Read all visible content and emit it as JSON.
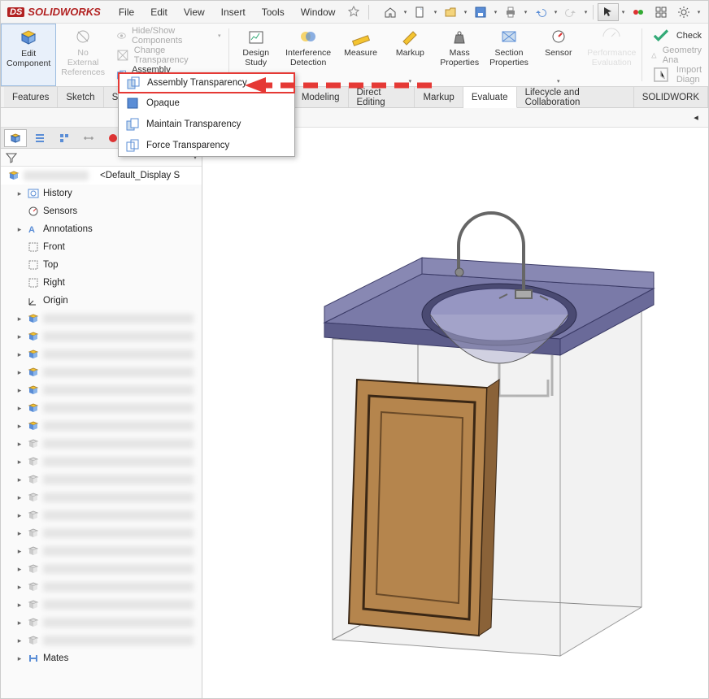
{
  "app": {
    "brand": "SOLIDWORKS"
  },
  "menu": [
    "File",
    "Edit",
    "View",
    "Insert",
    "Tools",
    "Window"
  ],
  "ribbon": {
    "edit_component": "Edit\nComponent",
    "no_external": "No\nExternal\nReferences",
    "hide_show": "Hide/Show Components",
    "change_transparency": "Change Transparency",
    "assembly_transparency": "Assembly Transparency",
    "design_study": "Design\nStudy",
    "interference": "Interference\nDetection",
    "measure": "Measure",
    "markup2": "Markup",
    "mass_props": "Mass\nProperties",
    "section_props": "Section\nProperties",
    "sensor": "Sensor",
    "perf_eval": "Performance\nEvaluation",
    "check": "Check",
    "geometry": "Geometry Ana",
    "import_diag": "Import Diagn"
  },
  "dropdown": {
    "assembly_transparency": "Assembly Transparency",
    "opaque": "Opaque",
    "maintain": "Maintain  Transparency",
    "force": "Force Transparency"
  },
  "tabs": [
    "Features",
    "Sketch",
    "Sur",
    "Modeling",
    "Direct Editing",
    "Markup",
    "Evaluate",
    "Lifecycle and Collaboration",
    "SOLIDWORK"
  ],
  "tree": {
    "root_suffix": "<Default_Display S",
    "history": "History",
    "sensors": "Sensors",
    "annotations": "Annotations",
    "front": "Front",
    "top": "Top",
    "right": "Right",
    "origin": "Origin",
    "mates": "Mates"
  }
}
